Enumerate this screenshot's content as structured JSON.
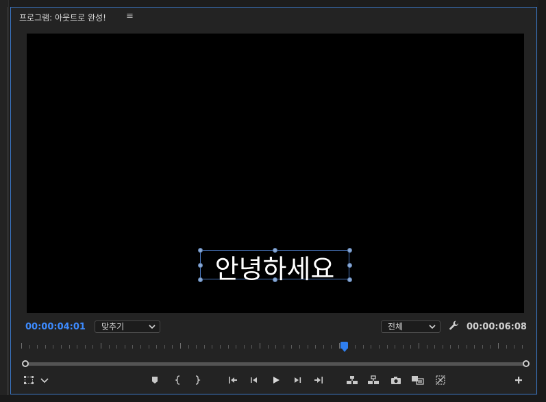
{
  "panel": {
    "title": "프로그램: 아웃트로 완성!",
    "menu_icon": "≡"
  },
  "viewer": {
    "caption_text": "안녕하세요"
  },
  "timecode": {
    "current": "00:00:04:01",
    "duration": "00:00:06:08"
  },
  "zoom_dropdown": {
    "selected": "맞추기"
  },
  "resolution_dropdown": {
    "selected": "전체"
  },
  "timeline": {
    "playhead_fraction": 0.63
  },
  "icons": {
    "menu": "hamburger-menu-icon",
    "settings": "wrench-icon",
    "safe_margins": "safe-margins-icon",
    "add": "plus-icon"
  },
  "colors": {
    "accent_blue": "#3d8bff",
    "panel_border": "#3b78c8",
    "background": "#232323",
    "viewer": "#000000"
  }
}
